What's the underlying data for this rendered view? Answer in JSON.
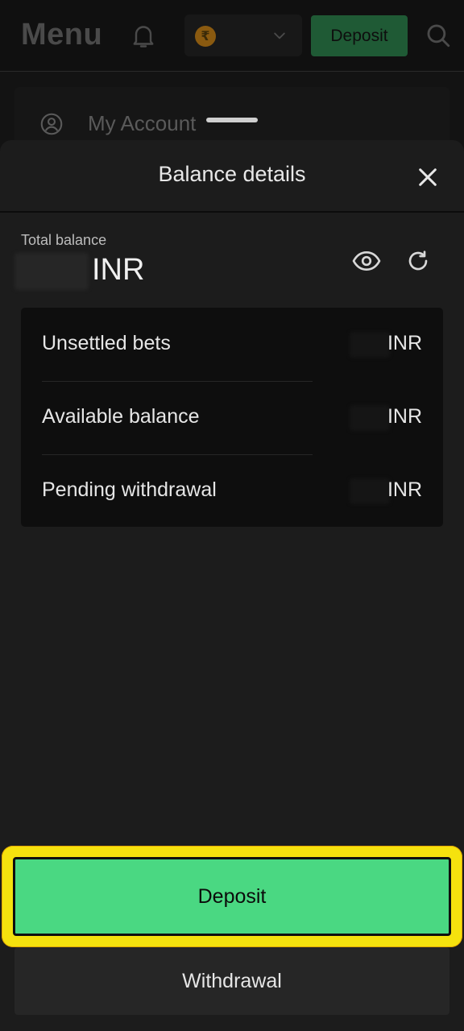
{
  "header": {
    "title": "Menu",
    "deposit_label": "Deposit",
    "currency_symbol": "₹",
    "icons": [
      "bell-icon",
      "chevron-down-icon",
      "search-icon"
    ]
  },
  "menu": {
    "account_label": "My Account"
  },
  "sheet": {
    "title": "Balance details",
    "total_label": "Total balance",
    "total_currency": "INR",
    "rows": [
      {
        "label": "Unsettled bets",
        "currency": "INR"
      },
      {
        "label": "Available balance",
        "currency": "INR"
      },
      {
        "label": "Pending withdrawal",
        "currency": "INR"
      }
    ],
    "deposit_label": "Deposit",
    "withdraw_label": "Withdrawal"
  },
  "colors": {
    "accent_green": "#4ad882",
    "highlight_yellow": "#f5e20e",
    "sheet_bg": "#1c1c1c"
  }
}
